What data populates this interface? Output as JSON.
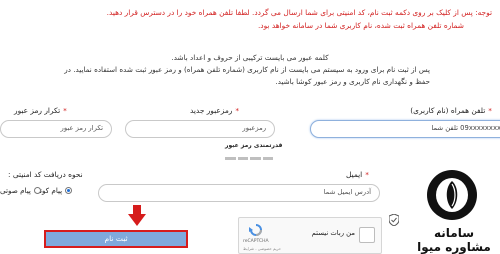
{
  "notice": {
    "line1": "توجه: پس از کلیک بر روی دکمه ثبت نام، کد امنیتی برای شما ارسال می گردد. لطفا تلفن همراه خود را در دسترس قرار دهید.",
    "line2": "شماره تلفن همراه ثبت شده، نام کاربری شما در سامانه خواهد بود."
  },
  "password_rule": "کلمه عبور می بایست ترکیبی از حروف و اعداد باشد.",
  "login_note": "پس از ثبت نام برای ورود به سیستم می بایست از نام کاربری (شماره تلفن همراه) و رمز عبور ثبت شده استفاده نمایید. در حفظ و نگهداری نام کاربری و رمز عبور کوشا باشید.",
  "form": {
    "mobile": {
      "label": "تلفن همراه (نام کاربری)",
      "value": "09xxxxxxxx تلفن شما"
    },
    "new_password": {
      "label": "رمزعبور جدید",
      "placeholder": "رمزعبور",
      "hint": "قدرتمندی رمز عبور"
    },
    "confirm_password": {
      "label": "تکرار رمز عبور",
      "placeholder": "تکرار رمز عبور"
    },
    "email": {
      "label": "ایمیل",
      "placeholder": "آدرس ایمیل شما"
    },
    "code_delivery": {
      "label": "نحوه دریافت کد امنیتی :",
      "options": [
        {
          "label": "پیام کوتاه",
          "selected": true
        },
        {
          "label": "پیام صوتی",
          "selected": false
        }
      ]
    },
    "submit_label": "ثبت نام"
  },
  "recaptcha": {
    "checkbox_label": "من ربات نیستم",
    "brand": "reCAPTCHA",
    "terms": "حریم خصوصی - شرایط"
  },
  "logo": {
    "text": "سامانه مشاوره میوا"
  },
  "colors": {
    "notice_red": "#d21f1f",
    "button_blue": "#7fa9dc",
    "highlight_red": "#d61c1c"
  },
  "required_mark": "*"
}
